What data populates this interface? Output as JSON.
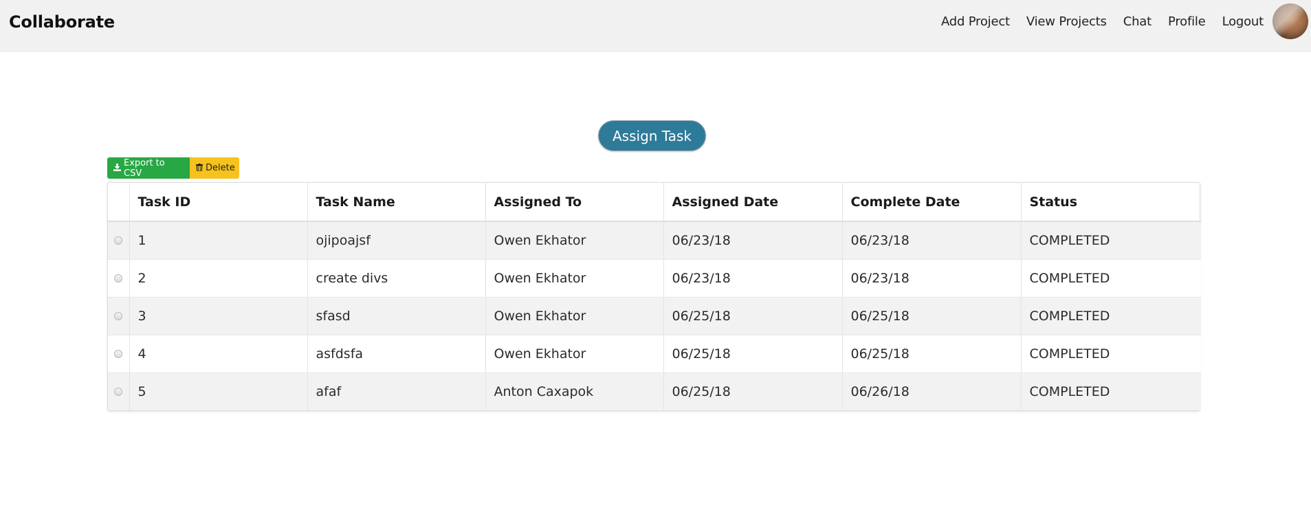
{
  "navbar": {
    "brand": "Collaborate",
    "links": [
      "Add Project",
      "View Projects",
      "Chat",
      "Profile",
      "Logout"
    ]
  },
  "assign_button": "Assign Task",
  "toolbar": {
    "export_label": "Export to CSV",
    "export_icon": "download-icon",
    "delete_label": "Delete",
    "delete_icon": "trash-icon"
  },
  "table": {
    "columns": [
      "Task ID",
      "Task Name",
      "Assigned To",
      "Assigned Date",
      "Complete Date",
      "Status"
    ],
    "rows": [
      {
        "id": "1",
        "name": "ojipoajsf",
        "assigned_to": "Owen Ekhator",
        "assigned_date": "06/23/18",
        "complete_date": "06/23/18",
        "status": "COMPLETED"
      },
      {
        "id": "2",
        "name": "create divs",
        "assigned_to": "Owen Ekhator",
        "assigned_date": "06/23/18",
        "complete_date": "06/23/18",
        "status": "COMPLETED"
      },
      {
        "id": "3",
        "name": "sfasd",
        "assigned_to": "Owen Ekhator",
        "assigned_date": "06/25/18",
        "complete_date": "06/25/18",
        "status": "COMPLETED"
      },
      {
        "id": "4",
        "name": "asfdsfa",
        "assigned_to": "Owen Ekhator",
        "assigned_date": "06/25/18",
        "complete_date": "06/25/18",
        "status": "COMPLETED"
      },
      {
        "id": "5",
        "name": "afaf",
        "assigned_to": "Anton Caxapok",
        "assigned_date": "06/25/18",
        "complete_date": "06/26/18",
        "status": "COMPLETED"
      }
    ]
  },
  "colors": {
    "navbar_bg": "#f1f1f1",
    "assign_button": "#2e7b99",
    "export_button": "#28a745",
    "delete_button": "#f6c21d",
    "row_stripe": "#f2f2f2"
  }
}
